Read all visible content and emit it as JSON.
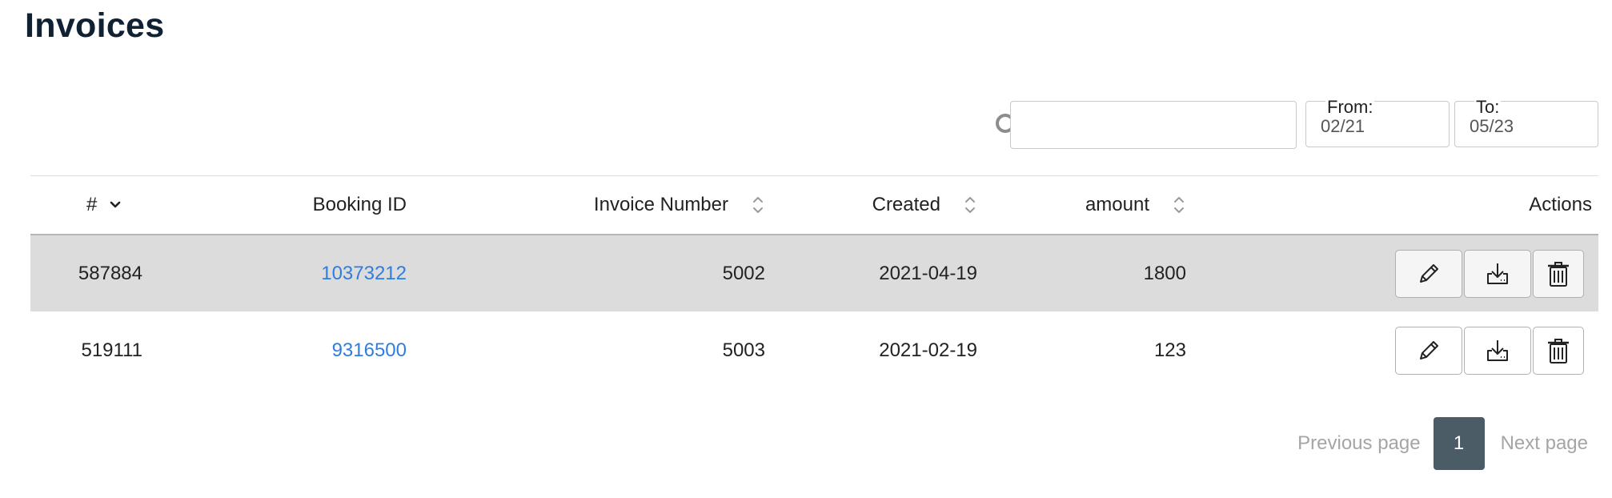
{
  "page": {
    "title": "Invoices"
  },
  "filters": {
    "search": {
      "value": "",
      "placeholder": ""
    },
    "from": {
      "label": "From:",
      "value": "02/21"
    },
    "to": {
      "label": "To:",
      "value": "05/23"
    }
  },
  "table": {
    "columns": {
      "id": "#",
      "booking": "Booking ID",
      "invoice": "Invoice Number",
      "created": "Created",
      "amount": "amount",
      "actions": "Actions"
    },
    "rows": [
      {
        "id": "587884",
        "booking_id": "10373212",
        "invoice_number": "5002",
        "created": "2021-04-19",
        "amount": "1800"
      },
      {
        "id": "519111",
        "booking_id": "9316500",
        "invoice_number": "5003",
        "created": "2021-02-19",
        "amount": "123"
      }
    ]
  },
  "pagination": {
    "previous": "Previous page",
    "current": "1",
    "next": "Next page"
  },
  "colors": {
    "title": "#0f2133",
    "link": "#2f7de1",
    "selected_row": "#dcdcdc",
    "page_current_bg": "#4c5c66",
    "page_link": "#a5a5a5"
  },
  "icons": {
    "search": "search-icon",
    "sort": "sort-updown-icon",
    "sort_desc": "chevron-down-icon",
    "edit": "pencil-icon",
    "download": "download-icon",
    "delete": "trash-icon"
  }
}
